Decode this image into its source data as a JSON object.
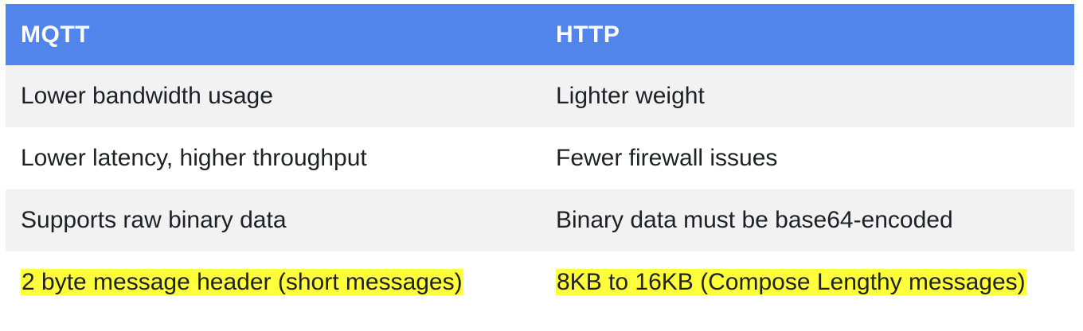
{
  "table": {
    "headers": [
      "MQTT",
      "HTTP"
    ],
    "rows": [
      [
        "Lower bandwidth usage",
        "Lighter weight"
      ],
      [
        "Lower latency, higher throughput",
        "Fewer firewall issues"
      ],
      [
        "Supports raw binary data",
        "Binary data must be base64-encoded"
      ],
      [
        "2 byte message header (short messages)",
        "8KB to 16KB (Compose Lengthy messages)"
      ]
    ],
    "highlight_color": "#ffff3b",
    "header_color": "#5285ec",
    "stripe_color": "#f2f2f2"
  }
}
